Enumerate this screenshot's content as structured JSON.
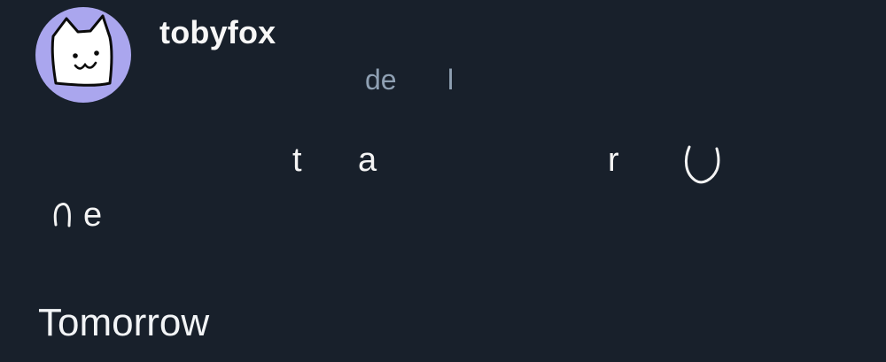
{
  "post": {
    "username": "tobyfox",
    "meta": {
      "fragment_1": "de",
      "fragment_2": "l"
    },
    "body": {
      "letter_t": "t",
      "letter_a": "a",
      "letter_r": "r",
      "letter_e": "e"
    },
    "footer_text": "Tomorrow"
  }
}
